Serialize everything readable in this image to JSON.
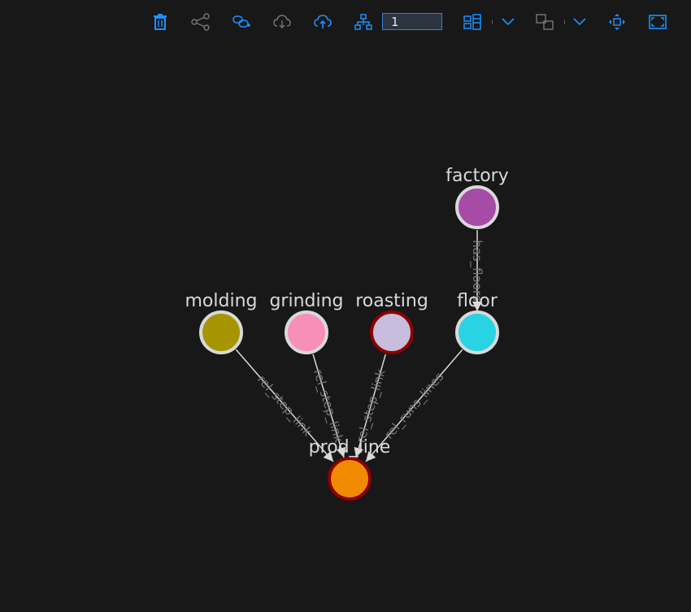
{
  "toolbar": {
    "depth_value": "1",
    "icons": [
      "trash-icon",
      "share-icon",
      "link-icon",
      "cloud-download-icon",
      "cloud-upload-icon",
      "hierarchy-icon",
      "layout-icon",
      "chevron-down-icon",
      "group-icon",
      "chevron-down-icon",
      "move-icon",
      "fit-screen-icon"
    ],
    "accent": "#1e90ff"
  },
  "graph": {
    "nodes": [
      {
        "id": "factory",
        "label": "factory",
        "color": "#a64ca6",
        "border": "#d9d9d9"
      },
      {
        "id": "molding",
        "label": "molding",
        "color": "#a69500",
        "border": "#d9d9d9"
      },
      {
        "id": "grinding",
        "label": "grinding",
        "color": "#f78fb8",
        "border": "#d9d9d9"
      },
      {
        "id": "roasting",
        "label": "roasting",
        "color": "#c8bddc",
        "border": "#8b0000"
      },
      {
        "id": "floor",
        "label": "floor",
        "color": "#29d3e3",
        "border": "#d9d9d9"
      },
      {
        "id": "prod_line",
        "label": "prod_line",
        "color": "#f28a00",
        "border": "#8b0000"
      }
    ],
    "edges": [
      {
        "from": "factory",
        "to": "floor",
        "label": "has_floors"
      },
      {
        "from": "molding",
        "to": "prod_line",
        "label": "rel_step_link"
      },
      {
        "from": "grinding",
        "to": "prod_line",
        "label": "rel_step_link"
      },
      {
        "from": "roasting",
        "to": "prod_line",
        "label": "rel_step_link"
      },
      {
        "from": "floor",
        "to": "prod_line",
        "label": "rel_runs_lines"
      }
    ]
  }
}
